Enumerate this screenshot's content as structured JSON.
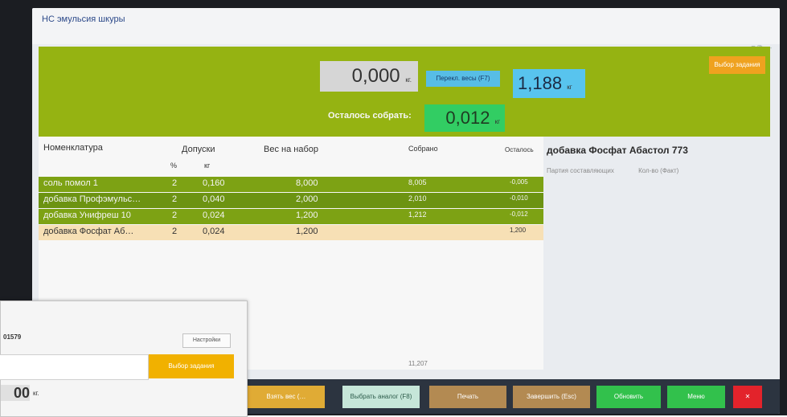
{
  "window": {
    "title": "НС эмульсия шкуры",
    "controls": "≡ ⧉ —"
  },
  "header": {
    "orange_button": "Выбор задания",
    "current_weight": "0,000",
    "weight_unit": "кг.",
    "switch_scale_button": "Перекл. весы (F7)",
    "target_weight": "1,188",
    "target_unit": "кг",
    "remain_label": "Осталось собрать:",
    "remain_value": "0,012",
    "remain_unit": "кг"
  },
  "table": {
    "columns": {
      "name": "Номенклатура",
      "tolerances": "Допуски",
      "percent": "%",
      "kg": "кг",
      "target": "Вес на набор",
      "collected": "Собрано",
      "remain": "Осталось"
    },
    "rows": [
      {
        "name": "соль помол 1",
        "pct": "2",
        "kg": "0,160",
        "target": "8,000",
        "collected": "8,005",
        "remain": "-0,005"
      },
      {
        "name": "добавка Профэмульс…",
        "pct": "2",
        "kg": "0,040",
        "target": "2,000",
        "collected": "2,010",
        "remain": "-0,010"
      },
      {
        "name": "добавка Унифреш 10",
        "pct": "2",
        "kg": "0,024",
        "target": "1,200",
        "collected": "1,212",
        "remain": "-0,012"
      },
      {
        "name": "добавка Фосфат Аб…",
        "pct": "2",
        "kg": "0,024",
        "target": "1,200",
        "collected": "",
        "remain": "1,200"
      }
    ],
    "footer_total": "11,207"
  },
  "side": {
    "title": "добавка Фосфат Абастол 773",
    "col1": "Партия составляющих",
    "col2": "Кол-во (Факт)"
  },
  "bottom": {
    "btn1": "Взять вес (…",
    "btn2": "Выбрать аналог (F8)",
    "btn3": "Печать",
    "btn4": "Завершить (Esc)",
    "btn5": "Обновить",
    "btn6": "Меню"
  },
  "popup": {
    "code": "01579",
    "settings_button": "Настройки",
    "task_button": "Выбор задания",
    "value": "00",
    "unit": "кг."
  }
}
